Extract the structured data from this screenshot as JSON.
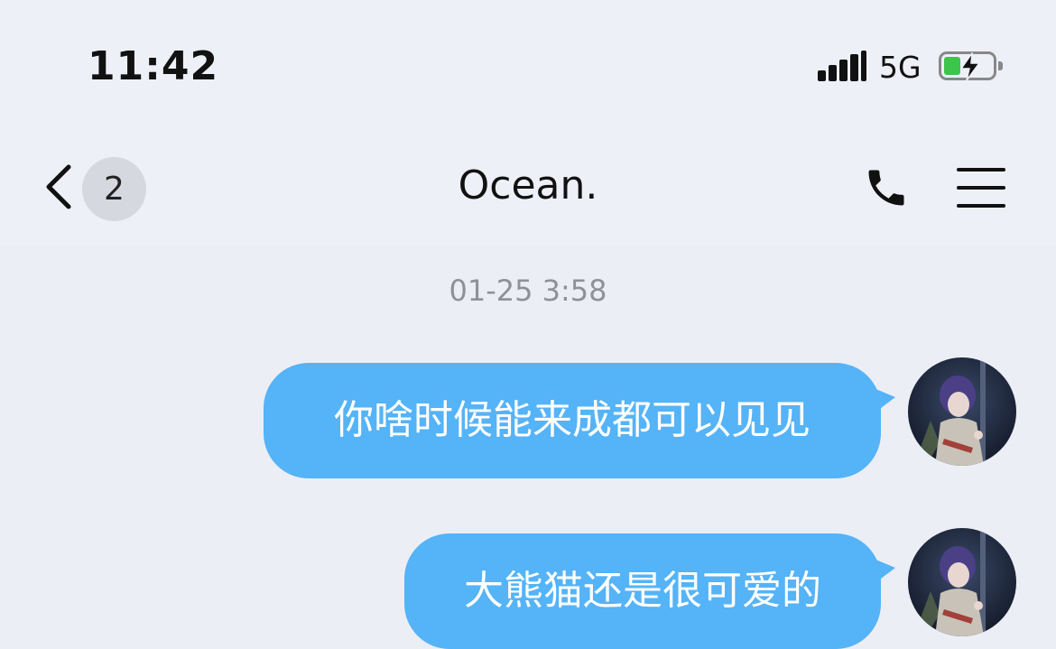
{
  "status_bar": {
    "time": "11:42",
    "network": "5G",
    "battery_icon": "battery-charging-icon"
  },
  "header": {
    "back_icon": "chevron-left-icon",
    "unread_count": "2",
    "title": "Ocean.",
    "call_icon": "phone-icon",
    "menu_icon": "menu-icon"
  },
  "conversation": {
    "timestamp": "01-25 3:58",
    "messages": [
      {
        "text": "你啥时候能来成都可以见见",
        "sender": "self"
      },
      {
        "text": "大熊猫还是很可爱的",
        "sender": "self"
      }
    ]
  },
  "colors": {
    "background": "#eceef6",
    "bubble": "#55b3f7",
    "battery_charge": "#3dc44a"
  }
}
